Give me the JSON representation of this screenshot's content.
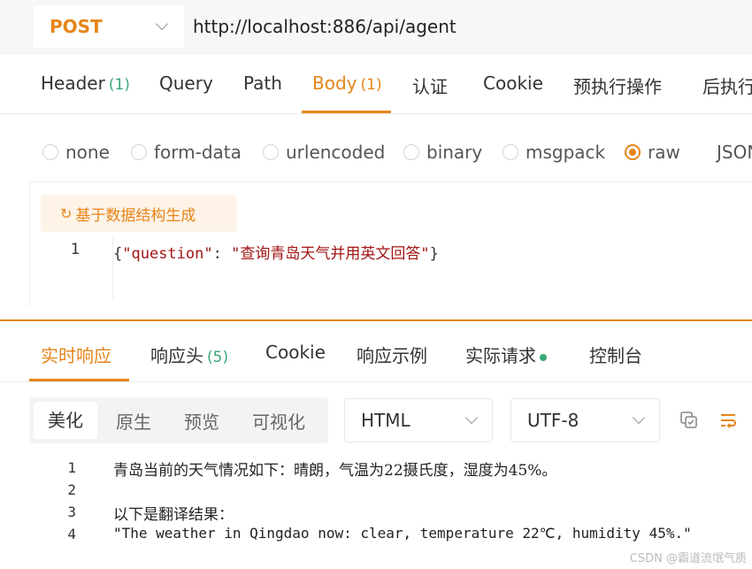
{
  "request": {
    "method": "POST",
    "url": "http://localhost:886/api/agent"
  },
  "request_tabs": [
    {
      "label": "Header",
      "count": "(1)"
    },
    {
      "label": "Query"
    },
    {
      "label": "Path"
    },
    {
      "label": "Body",
      "count": "(1)",
      "active": true
    },
    {
      "label": "认证"
    },
    {
      "label": "Cookie"
    },
    {
      "label": "预执行操作"
    },
    {
      "label": "后执行"
    }
  ],
  "body_types": [
    {
      "label": "none"
    },
    {
      "label": "form-data"
    },
    {
      "label": "urlencoded"
    },
    {
      "label": "binary"
    },
    {
      "label": "msgpack"
    },
    {
      "label": "raw",
      "selected": true
    },
    {
      "label": "JSON"
    }
  ],
  "generate_button": "基于数据结构生成",
  "body_code": {
    "line_number": "1",
    "open": "{",
    "key": "\"question\"",
    "colon": ": ",
    "value": "\"查询青岛天气并用英文回答\"",
    "close": "}"
  },
  "response_tabs": [
    {
      "label": "实时响应",
      "active": true
    },
    {
      "label": "响应头",
      "count": "(5)"
    },
    {
      "label": "Cookie"
    },
    {
      "label": "响应示例"
    },
    {
      "label": "实际请求"
    },
    {
      "label": "控制台"
    }
  ],
  "view_modes": [
    {
      "label": "美化",
      "active": true
    },
    {
      "label": "原生"
    },
    {
      "label": "预览"
    },
    {
      "label": "可视化"
    }
  ],
  "format_select": "HTML",
  "encoding_select": "UTF-8",
  "response_lines": [
    {
      "n": "1",
      "text": "青岛当前的天气情况如下：晴朗，气温为22摄氏度，湿度为45%。"
    },
    {
      "n": "2",
      "text": ""
    },
    {
      "n": "3",
      "text": "以下是翻译结果："
    },
    {
      "n": "4",
      "text": "\"The weather in Qingdao now: clear, temperature 22℃, humidity 45%.\""
    }
  ],
  "watermark": "CSDN @霸道流氓气质",
  "colors": {
    "accent": "#e68519",
    "success": "#3aa876"
  }
}
